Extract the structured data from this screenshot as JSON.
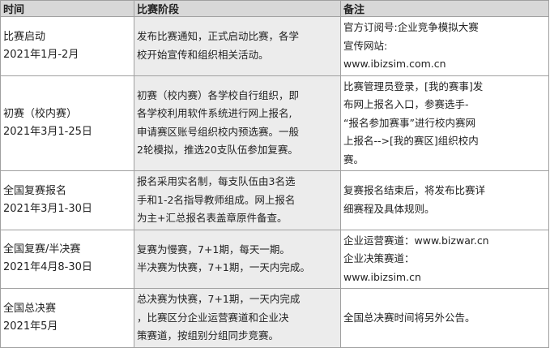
{
  "headers": {
    "stage_time": "时间",
    "phase": "比赛阶段",
    "notes": "备注"
  },
  "rows": [
    {
      "stage": "比赛启动",
      "date": "2021年1月-2月",
      "content": [
        "发布比赛通知，正式启动比赛，各学",
        "校开始宣传和组织相关活动。"
      ],
      "notes": [
        "官方订阅号:企业竞争模拟大赛",
        "宣传网站:",
        "www.ibizsim.com.cn"
      ]
    },
    {
      "stage": "初赛（校内赛）",
      "date": "2021年3月1-25日",
      "content": [
        "初赛（校内赛）各学校自行组织，即",
        "各学校利用软件系统进行网上报名,",
        "申请赛区账号组织校内预选赛。一般",
        "2轮模拟，推选20支队伍参加复赛。"
      ],
      "notes": [
        "比赛管理员登录，[我的赛事]发",
        "布网上报名入口，参赛选手-",
        "“报名参加赛事”进行校内赛网",
        "上报名-->[我的赛区]组织校内",
        "赛。"
      ]
    },
    {
      "stage": "全国复赛报名",
      "date": "2021年3月1-30日",
      "content": [
        "报名采用实名制，每支队伍由3名选",
        "手和1-2名指导教师组成。网上报名",
        "为主+汇总报名表盖章原件备查。"
      ],
      "notes": [
        "复赛报名结束后，将发布比赛详",
        "细赛程及具体规则。"
      ]
    },
    {
      "stage": "全国复赛/半决赛",
      "date": "2021年4月8-30日",
      "content": [
        "复赛为慢赛，7+1期，每天一期。",
        "半决赛为快赛，7+1期，一天内完成。"
      ],
      "notes": [
        "企业运营赛道：www.bizwar.cn",
        "企业决策赛道：",
        "www.ibizsim.cn"
      ]
    },
    {
      "stage": "全国总决赛",
      "date": "2021年5月",
      "content": [
        "总决赛为快赛，7+1期，一天内完成",
        "，比赛区分企业运营赛道和企业决",
        "策赛道，按组别分组同步竞赛。"
      ],
      "notes": [
        "全国总决赛时间将另外公告。"
      ]
    }
  ]
}
